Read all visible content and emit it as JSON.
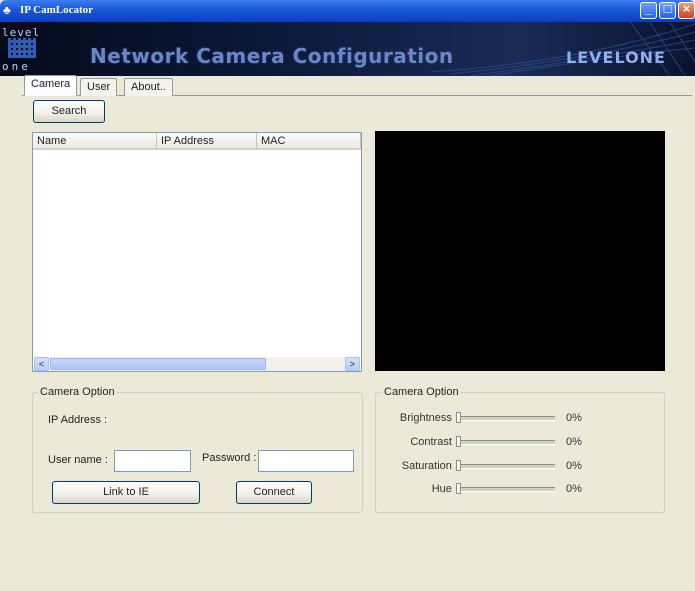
{
  "window": {
    "title": "IP CamLocator"
  },
  "banner": {
    "title": "Network Camera Configuration",
    "brand_top": "level",
    "brand_bottom": "one",
    "logo": "LEVELONE"
  },
  "tabs": [
    {
      "label": "Camera",
      "active": true
    },
    {
      "label": "User",
      "active": false
    },
    {
      "label": "About..",
      "active": false
    }
  ],
  "search": {
    "label": "Search"
  },
  "camera_list": {
    "columns": [
      "Name",
      "IP Address",
      "MAC"
    ],
    "rows": []
  },
  "connection_group": {
    "title": "Camera Option",
    "ip_label": "IP Address :",
    "username_label": "User name :",
    "username_value": "",
    "password_label": "Password :",
    "password_value": "",
    "link_button": "Link to IE",
    "connect_button": "Connect"
  },
  "image_group": {
    "title": "Camera Option",
    "sliders": [
      {
        "label": "Brightness :",
        "value": "0%",
        "level": 0
      },
      {
        "label": "Contrast :",
        "value": "0%",
        "level": 0
      },
      {
        "label": "Saturation :",
        "value": "0%",
        "level": 0
      },
      {
        "label": "Hue :",
        "value": "0%",
        "level": 0
      }
    ]
  },
  "colors": {
    "titlebar": "#1a56d8",
    "window_bg": "#ece9d8",
    "preview_bg": "#000000"
  },
  "icons": [
    "app-icon",
    "minimize-icon",
    "maximize-icon",
    "close-icon",
    "chevron-left-icon",
    "chevron-right-icon"
  ]
}
